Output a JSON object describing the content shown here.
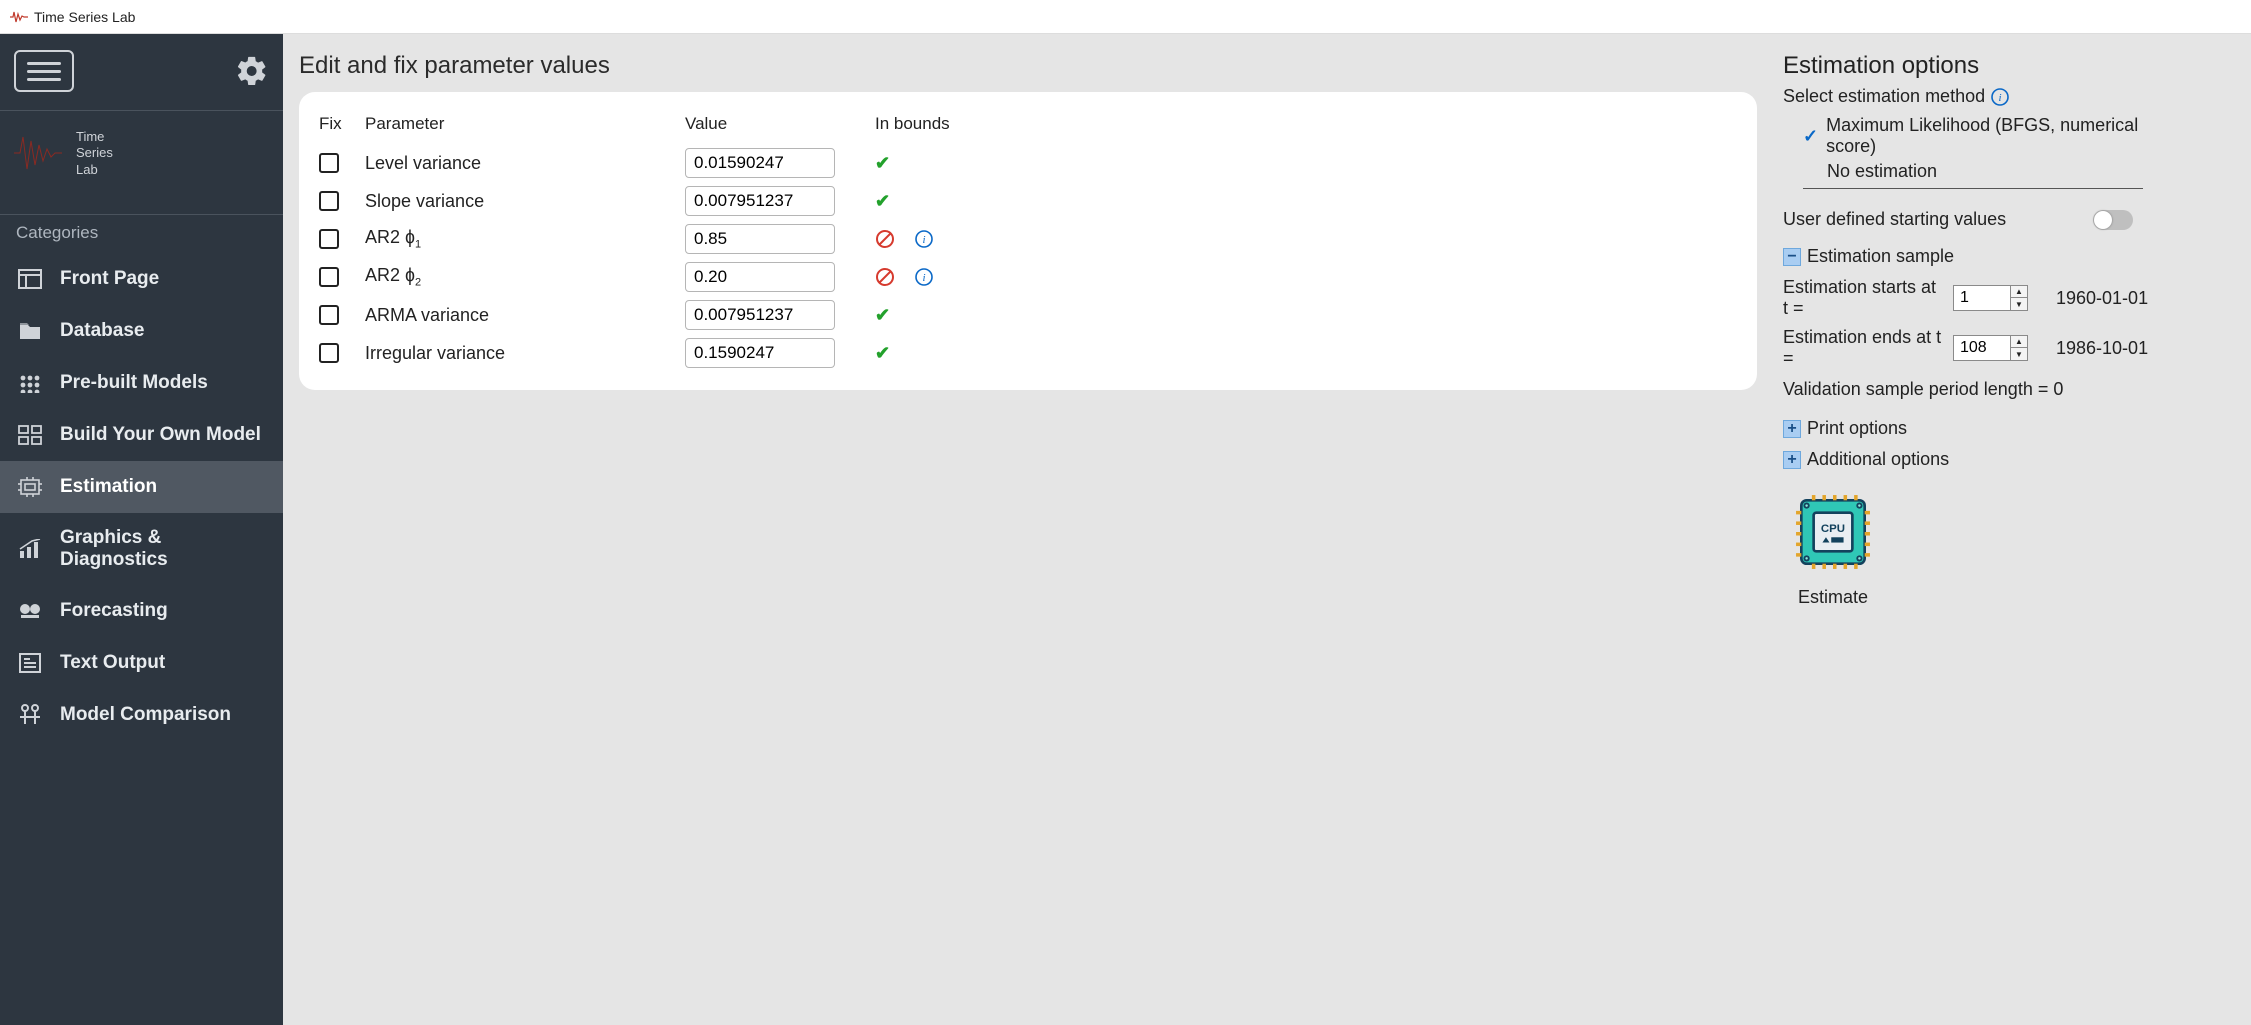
{
  "titlebar": {
    "app_name": "Time Series Lab"
  },
  "brand": {
    "line1": "Time",
    "line2": "Series",
    "line3": "Lab"
  },
  "sidebar": {
    "categories_label": "Categories",
    "items": [
      {
        "label": "Front Page"
      },
      {
        "label": "Database"
      },
      {
        "label": "Pre-built Models"
      },
      {
        "label": "Build Your Own Model"
      },
      {
        "label": "Estimation"
      },
      {
        "label": "Graphics & Diagnostics"
      },
      {
        "label": "Forecasting"
      },
      {
        "label": "Text Output"
      },
      {
        "label": "Model Comparison"
      }
    ],
    "active_index": 4
  },
  "main": {
    "title": "Edit and fix parameter values",
    "headers": {
      "fix": "Fix",
      "parameter": "Parameter",
      "value": "Value",
      "in_bounds": "In bounds"
    },
    "rows": [
      {
        "name": "Level variance",
        "value": "0.01590247",
        "status": "ok"
      },
      {
        "name": "Slope variance",
        "value": "0.007951237",
        "status": "ok"
      },
      {
        "name": "AR2 φ1",
        "name_html": "AR2 <span class='phi'>ɸ</span><sub>1</sub>",
        "value": "0.85",
        "status": "warn"
      },
      {
        "name": "AR2 φ2",
        "name_html": "AR2 <span class='phi'>ɸ</span><sub>2</sub>",
        "value": "0.20",
        "status": "warn"
      },
      {
        "name": "ARMA variance",
        "value": "0.007951237",
        "status": "ok"
      },
      {
        "name": "Irregular variance",
        "value": "0.1590247",
        "status": "ok"
      }
    ]
  },
  "right": {
    "title": "Estimation options",
    "method_label": "Select estimation method",
    "methods": [
      {
        "label": "Maximum Likelihood (BFGS, numerical score)",
        "selected": true
      },
      {
        "label": "No estimation",
        "selected": false
      }
    ],
    "user_sv_label": "User defined starting values",
    "user_sv_on": false,
    "sample_section_label": "Estimation sample",
    "start_label": "Estimation starts at t =",
    "start_value": "1",
    "start_date": "1960-01-01",
    "end_label": "Estimation ends at t =",
    "end_value": "108",
    "end_date": "1986-10-01",
    "validation_label": "Validation sample period length = 0",
    "print_options_label": "Print options",
    "additional_options_label": "Additional options",
    "estimate_label": "Estimate",
    "cpu_text": "CPU"
  }
}
